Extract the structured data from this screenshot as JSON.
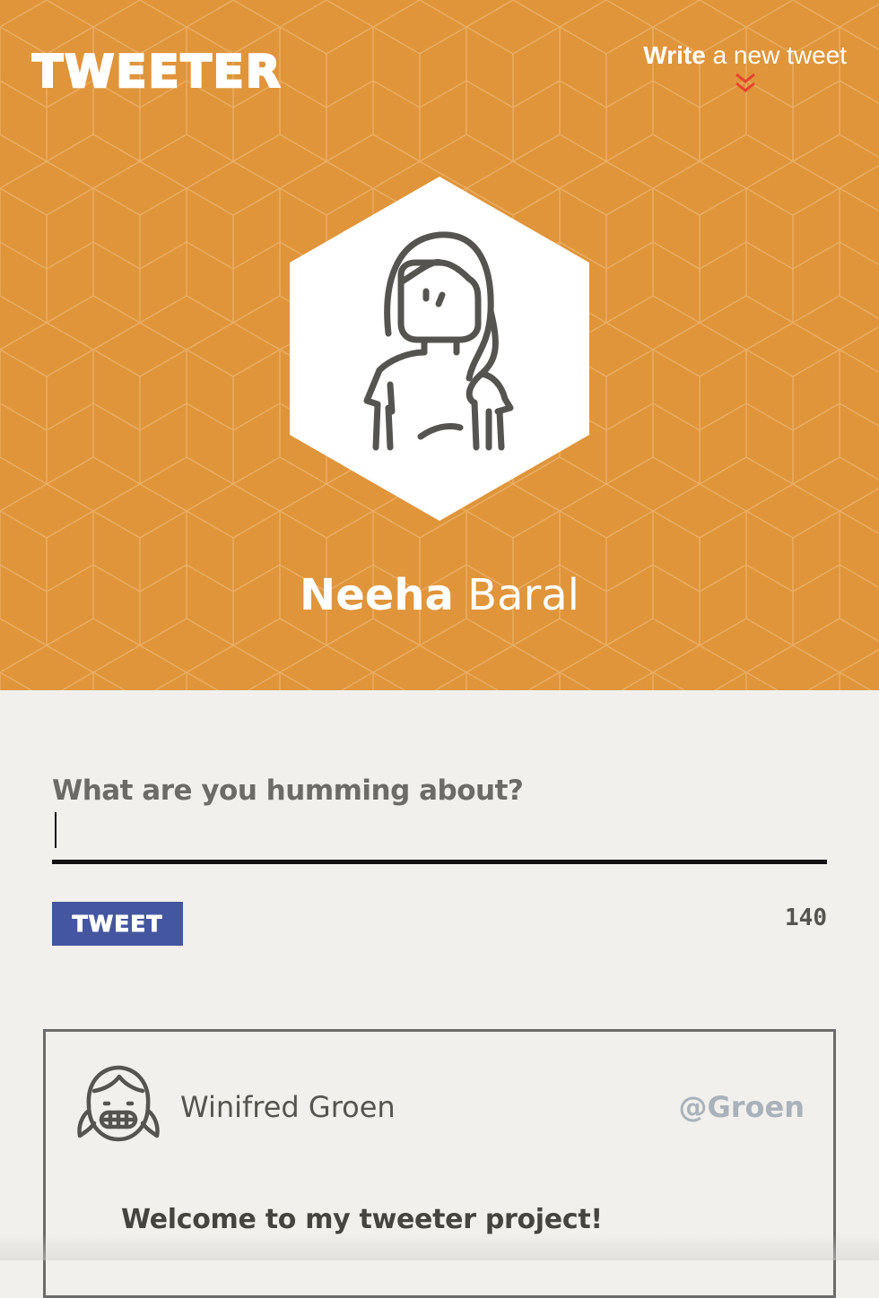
{
  "header": {
    "brand": "TWEETER",
    "compose_link_bold": "Write",
    "compose_link_rest": " a new tweet",
    "compose_icon": "double-chevron-down-icon",
    "background_color": "#e0953a",
    "accent_color": "#e8412e"
  },
  "profile": {
    "first_name": "Neeha",
    "last_name": " Baral",
    "avatar_icon": "girl-avatar-icon"
  },
  "composer": {
    "label": "What are you humming about?",
    "value": "",
    "button_label": "TWEET",
    "char_count": "140",
    "button_color": "#4456a0"
  },
  "tweets": [
    {
      "author": "Winifred Groen",
      "handle": "@Groen",
      "text": "Welcome to my tweeter project!",
      "avatar_icon": "grinning-girl-avatar-icon"
    }
  ]
}
